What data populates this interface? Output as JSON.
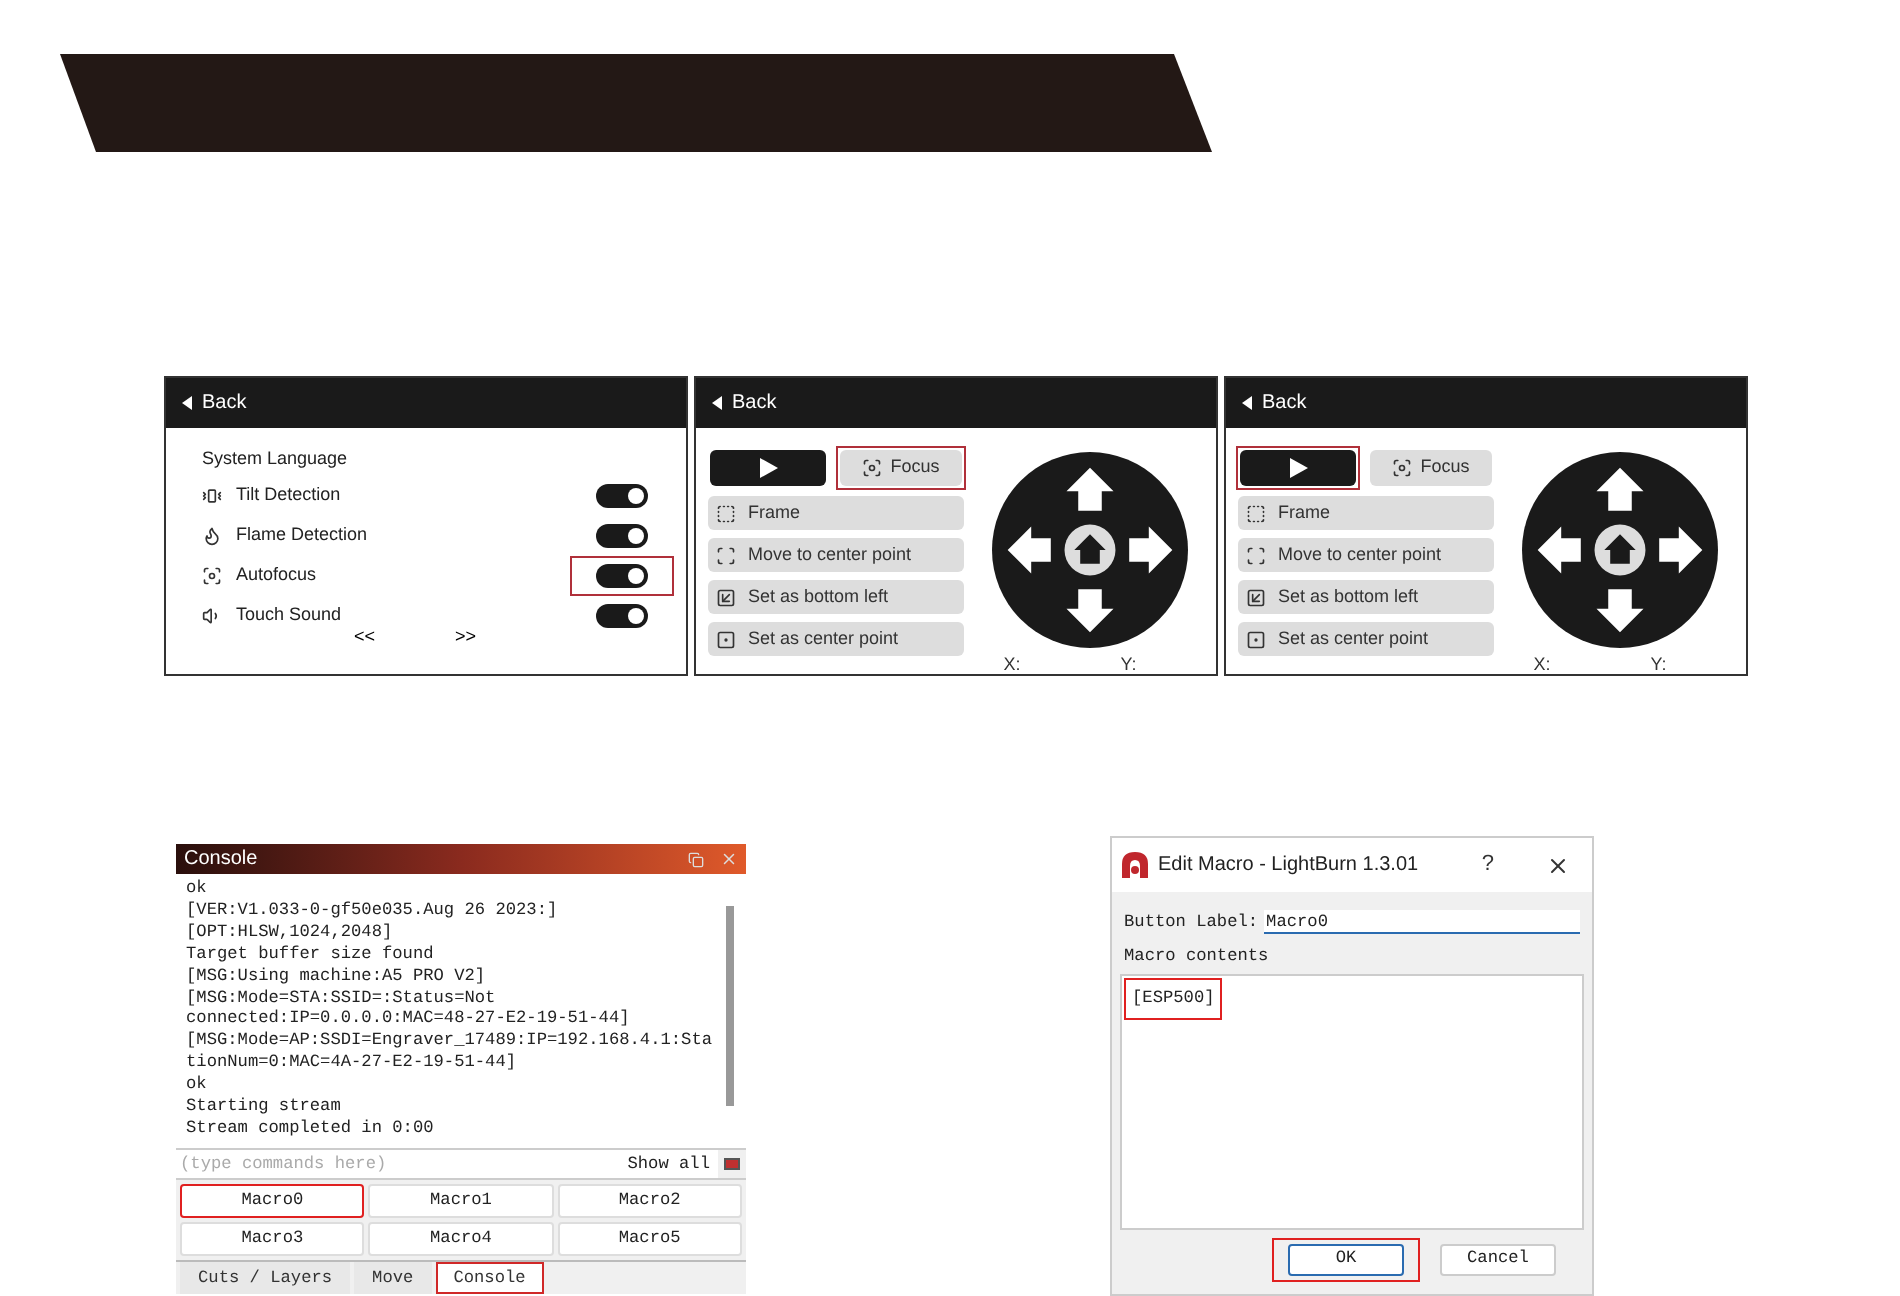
{
  "settings_screen": {
    "back": "Back",
    "title": "System Language",
    "settings": [
      {
        "label": "Tilt Detection",
        "on": true,
        "highlighted": false
      },
      {
        "label": "Flame Detection",
        "on": true,
        "highlighted": false
      },
      {
        "label": "Autofocus",
        "on": true,
        "highlighted": true
      },
      {
        "label": "Touch Sound",
        "on": true,
        "highlighted": false
      }
    ],
    "page_prev": "<<",
    "page_next": ">>"
  },
  "control_screens": [
    {
      "back": "Back",
      "play_highlighted": false,
      "focus": {
        "label": "Focus",
        "highlighted": true
      },
      "buttons": [
        "Frame",
        "Move to center point",
        "Set as bottom left",
        "Set as center point"
      ],
      "x_label": "X:",
      "y_label": "Y:"
    },
    {
      "back": "Back",
      "play_highlighted": true,
      "focus": {
        "label": "Focus",
        "highlighted": false
      },
      "buttons": [
        "Frame",
        "Move to center point",
        "Set as bottom left",
        "Set as center point"
      ],
      "x_label": "X:",
      "y_label": "Y:"
    }
  ],
  "console": {
    "title": "Console",
    "lines": [
      "ok",
      "[VER:V1.033-0-gf50e035.Aug 26 2023:]",
      "[OPT:HLSW,1024,2048]",
      "Target buffer size found",
      "[MSG:Using machine:A5 PRO V2]",
      "[MSG:Mode=STA:SSID=:Status=Not",
      "connected:IP=0.0.0.0:MAC=48-27-E2-19-51-44]",
      "[MSG:Mode=AP:SSDI=Engraver_17489:IP=192.168.4.1:Sta",
      "tionNum=0:MAC=4A-27-E2-19-51-44]",
      "ok",
      "Starting stream",
      "Stream completed in 0:00"
    ],
    "command_placeholder": "(type commands here)",
    "show_all": "Show all",
    "macros": [
      {
        "label": "Macro0",
        "highlighted": true
      },
      {
        "label": "Macro1",
        "highlighted": false
      },
      {
        "label": "Macro2",
        "highlighted": false
      },
      {
        "label": "Macro3",
        "highlighted": false
      },
      {
        "label": "Macro4",
        "highlighted": false
      },
      {
        "label": "Macro5",
        "highlighted": false
      }
    ],
    "tabs": [
      {
        "label": "Cuts / Layers",
        "selected": false,
        "highlighted": false
      },
      {
        "label": "Move",
        "selected": false,
        "highlighted": false
      },
      {
        "label": "Console",
        "selected": true,
        "highlighted": true
      }
    ]
  },
  "dialog": {
    "title": "Edit Macro - LightBurn 1.3.01",
    "help": "?",
    "button_label": "Button Label:",
    "button_label_value": "Macro0",
    "contents_label": "Macro contents",
    "contents": "[ESP500]",
    "contents_highlighted": true,
    "buttons": [
      {
        "label": "OK",
        "highlighted": true
      },
      {
        "label": "Cancel",
        "highlighted": false
      }
    ]
  }
}
